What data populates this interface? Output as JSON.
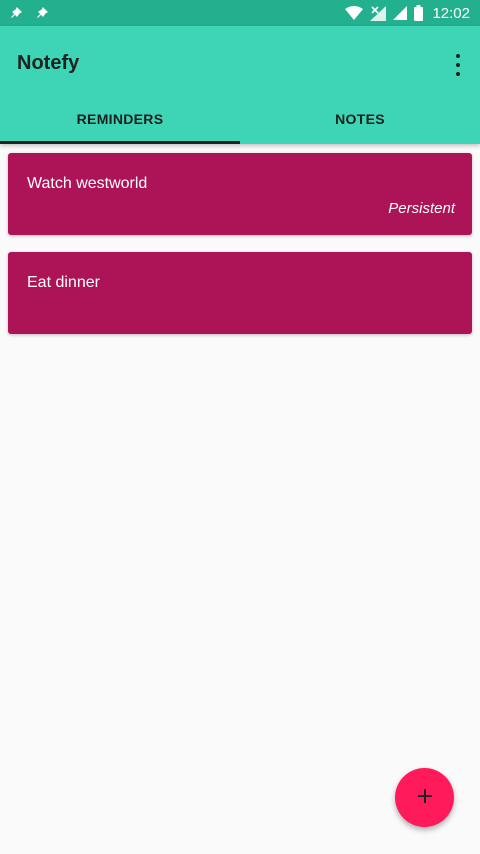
{
  "status_bar": {
    "time": "12:02",
    "icons": [
      "pin-icon",
      "pin-icon",
      "wifi-icon",
      "signal-no-data-icon",
      "signal-icon",
      "battery-icon"
    ]
  },
  "app_bar": {
    "title": "Notefy",
    "menu_icon": "more-vert-icon"
  },
  "tabs": [
    {
      "label": "REMINDERS",
      "selected": true
    },
    {
      "label": "NOTES",
      "selected": false
    }
  ],
  "reminders": [
    {
      "title": "Watch westworld",
      "tag": "Persistent"
    },
    {
      "title": "Eat dinner",
      "tag": ""
    }
  ],
  "fab": {
    "icon": "add-icon"
  },
  "colors": {
    "status_bar": "#23b08e",
    "app_bar": "#3dd5b5",
    "card": "#ad1457",
    "fab": "#ff1a5c",
    "background": "#fafafa"
  }
}
